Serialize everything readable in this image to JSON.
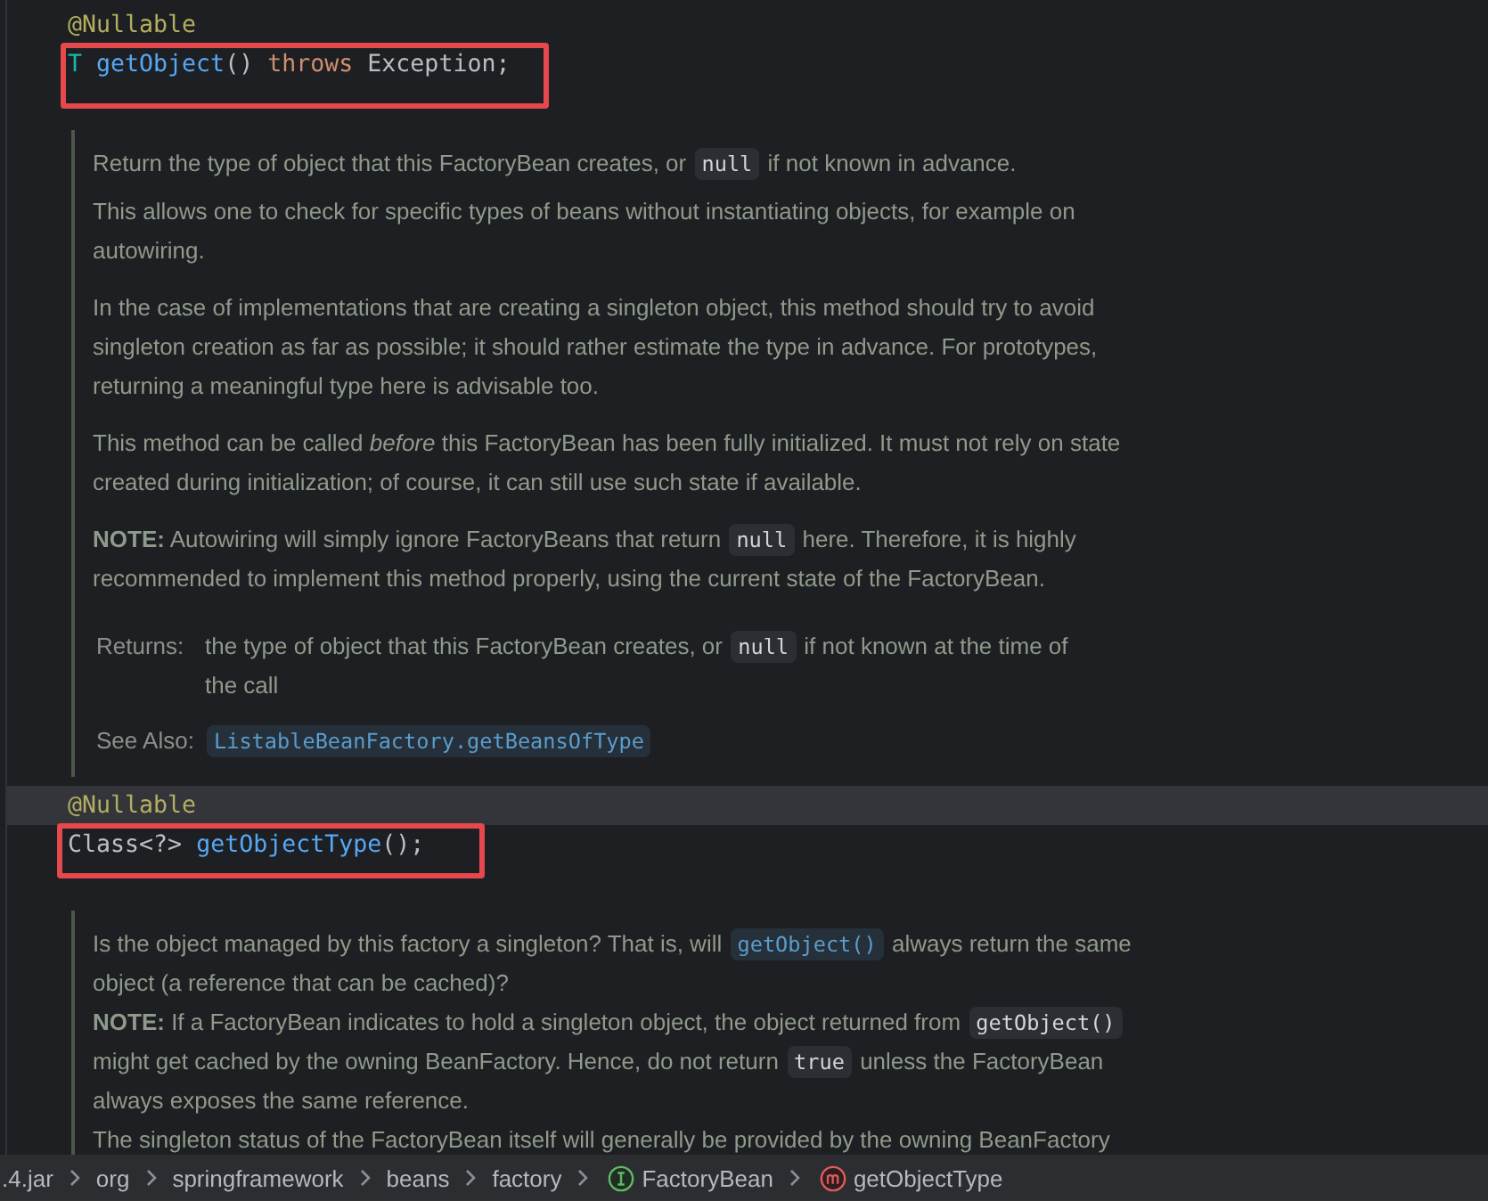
{
  "declarations": [
    {
      "annotation": "@Nullable",
      "current_line": false,
      "signature": [
        {
          "kind": "type_param",
          "text": "T "
        },
        {
          "kind": "method",
          "text": "getObject"
        },
        {
          "kind": "plain",
          "text": "() "
        },
        {
          "kind": "keyword",
          "text": "throws"
        },
        {
          "kind": "plain",
          "text": " Exception;"
        }
      ],
      "doc": {
        "paragraphs": [
          {
            "lines": [
              [
                {
                  "kind": "text",
                  "text": "Return the type of object that this FactoryBean creates, or "
                },
                {
                  "kind": "code",
                  "text": "null"
                },
                {
                  "kind": "text",
                  "text": " if not known in advance."
                }
              ]
            ]
          },
          {
            "lines": [
              [
                {
                  "kind": "text",
                  "text": "This allows one to check for specific types of beans without instantiating objects, for example on"
                }
              ],
              [
                {
                  "kind": "text",
                  "text": "autowiring."
                }
              ]
            ]
          },
          {
            "lines": [
              [
                {
                  "kind": "text",
                  "text": "In the case of implementations that are creating a singleton object, this method should try to avoid"
                }
              ],
              [
                {
                  "kind": "text",
                  "text": "singleton creation as far as possible; it should rather estimate the type in advance. For prototypes,"
                }
              ],
              [
                {
                  "kind": "text",
                  "text": "returning a meaningful type here is advisable too."
                }
              ]
            ]
          },
          {
            "lines": [
              [
                {
                  "kind": "text",
                  "text": "This method can be called *before* this FactoryBean has been fully initialized. It must not rely on state"
                }
              ],
              [
                {
                  "kind": "text",
                  "text": "created during initialization; of course, it can still use such state if available."
                }
              ]
            ]
          },
          {
            "lines": [
              [
                {
                  "kind": "text",
                  "text": "**NOTE:** Autowiring will simply ignore FactoryBeans that return "
                },
                {
                  "kind": "code",
                  "text": "null"
                },
                {
                  "kind": "text",
                  "text": " here. Therefore, it is highly"
                }
              ],
              [
                {
                  "kind": "text",
                  "text": "recommended to implement this method properly, using the current state of the FactoryBean."
                }
              ]
            ]
          }
        ],
        "tags": [
          {
            "label": "Returns:",
            "lines": [
              [
                {
                  "kind": "text",
                  "text": "the type of object that this FactoryBean creates, or "
                },
                {
                  "kind": "code",
                  "text": "null"
                },
                {
                  "kind": "text",
                  "text": " if not known at the time of"
                }
              ],
              [
                {
                  "kind": "text",
                  "text": "the call"
                }
              ]
            ]
          },
          {
            "label": "See Also:",
            "lines": [
              [
                {
                  "kind": "link",
                  "text": "ListableBeanFactory.getBeansOfType"
                }
              ]
            ]
          }
        ]
      }
    },
    {
      "annotation": "@Nullable",
      "current_line": true,
      "signature": [
        {
          "kind": "plain",
          "text": "Class<?> "
        },
        {
          "kind": "method",
          "text": "getObjectType"
        },
        {
          "kind": "plain",
          "text": "();"
        }
      ],
      "doc": {
        "paragraphs": [
          {
            "lines": [
              [
                {
                  "kind": "text",
                  "text": "Is the object managed by this factory a singleton? That is, will "
                },
                {
                  "kind": "link",
                  "text": "getObject()"
                },
                {
                  "kind": "text",
                  "text": " always return the same"
                }
              ],
              [
                {
                  "kind": "text",
                  "text": "object (a reference that can be cached)?"
                }
              ]
            ]
          },
          {
            "lines": [
              [
                {
                  "kind": "text",
                  "text": "**NOTE:** If a FactoryBean indicates to hold a singleton object, the object returned from "
                },
                {
                  "kind": "code",
                  "text": "getObject()"
                }
              ],
              [
                {
                  "kind": "text",
                  "text": "might get cached by the owning BeanFactory. Hence, do not return "
                },
                {
                  "kind": "code",
                  "text": "true"
                },
                {
                  "kind": "text",
                  "text": " unless the FactoryBean"
                }
              ],
              [
                {
                  "kind": "text",
                  "text": "always exposes the same reference."
                }
              ]
            ]
          },
          {
            "lines": [
              [
                {
                  "kind": "text",
                  "text": "The singleton status of the FactoryBean itself will generally be provided by the owning BeanFactory"
                }
              ]
            ]
          }
        ]
      }
    }
  ],
  "breadcrumbs": [
    {
      "kind": "plain",
      "label": ".4.jar"
    },
    {
      "kind": "plain",
      "label": "org"
    },
    {
      "kind": "plain",
      "label": "springframework"
    },
    {
      "kind": "plain",
      "label": "beans"
    },
    {
      "kind": "plain",
      "label": "factory"
    },
    {
      "kind": "interface",
      "label": "FactoryBean"
    },
    {
      "kind": "method",
      "label": "getObjectType"
    }
  ]
}
